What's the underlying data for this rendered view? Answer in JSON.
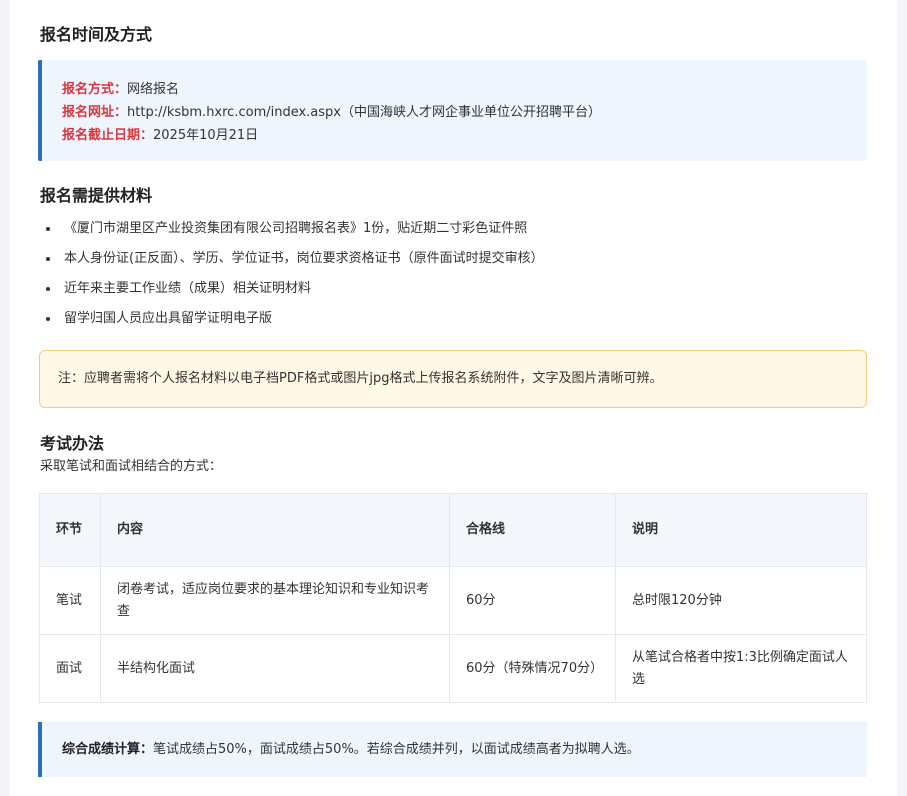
{
  "registration": {
    "title": "报名时间及方式",
    "method_label": "报名方式：",
    "method_value": "网络报名",
    "url_label": "报名网址：",
    "url_value": "http://ksbm.hxrc.com/index.aspx（中国海峡人才网企事业单位公开招聘平台）",
    "deadline_label": "报名截止日期：",
    "deadline_value": "2025年10月21日"
  },
  "materials": {
    "title": "报名需提供材料",
    "items": [
      "《厦门市湖里区产业投资集团有限公司招聘报名表》1份，贴近期二寸彩色证件照",
      "本人身份证(正反面）、学历、学位证书，岗位要求资格证书（原件面试时提交审核）",
      "近年来主要工作业绩（成果）相关证明材料",
      "留学归国人员应出具留学证明电子版"
    ],
    "note": "注：应聘者需将个人报名材料以电子档PDF格式或图片jpg格式上传报名系统附件，文字及图片清晰可辨。"
  },
  "exam": {
    "title": "考试办法",
    "subtitle": "采取笔试和面试相结合的方式：",
    "headers": [
      "环节",
      "内容",
      "合格线",
      "说明"
    ],
    "rows": [
      [
        "笔试",
        "闭卷考试，适应岗位要求的基本理论知识和专业知识考查",
        "60分",
        "总时限120分钟"
      ],
      [
        "面试",
        "半结构化面试",
        "60分（特殊情况70分）",
        "从笔试合格者中按1:3比例确定面试人选"
      ]
    ]
  },
  "summary": {
    "label": "综合成绩计算：",
    "text": "笔试成绩占50%，面试成绩占50%。若综合成绩并列，以面试成绩高者为拟聘人选。"
  }
}
